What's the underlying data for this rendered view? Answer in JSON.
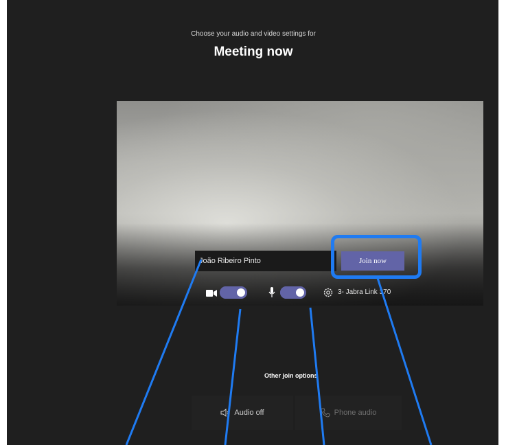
{
  "header": {
    "subtitle": "Choose your audio and video settings for",
    "title": "Meeting now"
  },
  "prejoin": {
    "name_value": "João Ribeiro Pinto",
    "join_label": "Join now",
    "video_enabled": true,
    "mic_enabled": true,
    "audio_device": "3- Jabra Link 370"
  },
  "other_options": {
    "label": "Other join options",
    "audio_off_label": "Audio off",
    "phone_audio_label": "Phone audio"
  },
  "colors": {
    "background": "#1f1f1f",
    "accent": "#6264a7",
    "annotation": "#1f7bf2"
  },
  "icons": [
    "camera-icon",
    "mic-icon",
    "gear-icon",
    "speaker-off-icon",
    "phone-icon"
  ]
}
